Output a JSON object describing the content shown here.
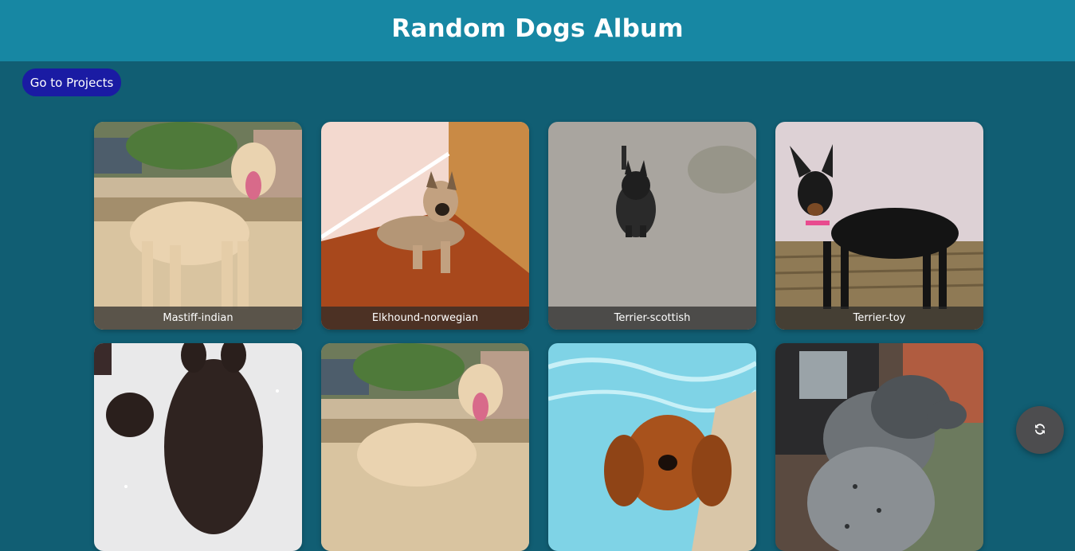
{
  "header": {
    "title": "Random Dogs Album"
  },
  "nav": {
    "projects_label": "Go to Projects"
  },
  "dogs": [
    {
      "breed": "Mastiff-indian"
    },
    {
      "breed": "Elkhound-norwegian"
    },
    {
      "breed": "Terrier-scottish"
    },
    {
      "breed": "Terrier-toy"
    },
    {
      "breed": ""
    },
    {
      "breed": ""
    },
    {
      "breed": ""
    },
    {
      "breed": ""
    }
  ],
  "refresh": {
    "icon": "refresh-icon"
  },
  "colors": {
    "header": "#1787a3",
    "background": "#115e73",
    "button": "#1a1ba3",
    "fab": "#4d4d4f"
  }
}
